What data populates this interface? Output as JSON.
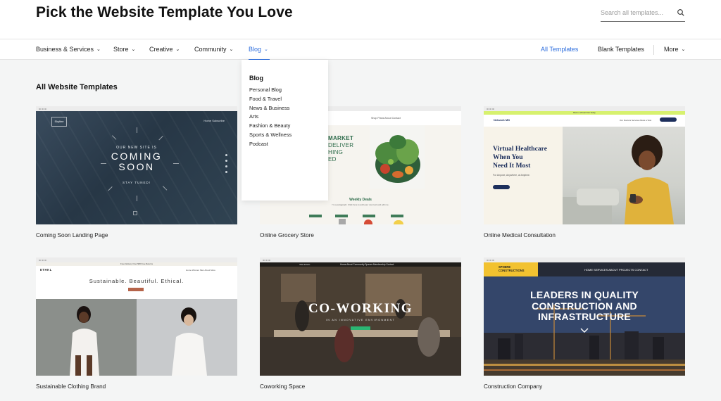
{
  "header": {
    "title": "Pick the Website Template You Love",
    "search_placeholder": "Search all templates..."
  },
  "nav": {
    "left": [
      {
        "label": "Business & Services"
      },
      {
        "label": "Store"
      },
      {
        "label": "Creative"
      },
      {
        "label": "Community"
      },
      {
        "label": "Blog",
        "active": true
      }
    ],
    "right": [
      {
        "label": "All Templates",
        "active": true
      },
      {
        "label": "Blank Templates"
      },
      {
        "label": "More"
      }
    ]
  },
  "dropdown": {
    "heading": "Blog",
    "items": [
      "Personal Blog",
      "Food & Travel",
      "News & Business",
      "Arts",
      "Fashion & Beauty",
      "Sports & Wellness",
      "Podcast"
    ]
  },
  "section_title": "All Website Templates",
  "templates": [
    {
      "label": "Coming Soon Landing Page",
      "thumb": {
        "logo": "Skyline",
        "nav": "Home   Subscribe",
        "eyebrow": "OUR NEW SITE IS",
        "headline_1": "COMING",
        "headline_2": "SOON",
        "footer": "STAY TUNED!"
      }
    },
    {
      "label": "Online Grocery Store",
      "thumb": {
        "nav": "Shop   Plans   About   Contact",
        "hero_1": "MARKET",
        "hero_2": "DELIVER",
        "hero_3": "HING",
        "hero_4": "ED",
        "section": "Weekly Deals",
        "section_sub": "I'm a paragraph. Click here to add your own text and edit me."
      }
    },
    {
      "label": "Online Medical Consultation",
      "thumb": {
        "banner": "Book a Virtual Visit Today",
        "logo": "Network MD",
        "nav": "Our Doctors   Services   Book a Visit",
        "headline_1": "Virtual Healthcare",
        "headline_2": "When You",
        "headline_3": "Need It Most",
        "sub": "For Anyone, Anywhere, at Anytime."
      }
    },
    {
      "label": "Sustainable Clothing Brand",
      "thumb": {
        "banner": "Free Delivery Over $50   Free Returns",
        "logo": "ETHKL",
        "nav": "Home   Women   Men   About   More",
        "headline": "Sustainable. Beautiful. Ethical."
      }
    },
    {
      "label": "Coworking Space",
      "thumb": {
        "logo": "The Annex.",
        "nav": "Home   About   Community   Spaces   Membership   Contact",
        "headline": "CO-WORKING",
        "sub": "IN AN INNOVATIVE ENVIRONMENT"
      }
    },
    {
      "label": "Construction Company",
      "thumb": {
        "logo_1": "SPHERE",
        "logo_2": "CONSTRUCTIONS",
        "nav": "HOME     SERVICES     ABOUT     PROJECTS     CONTACT",
        "headline_1": "LEADERS IN QUALITY",
        "headline_2": "CONSTRUCTION AND",
        "headline_3": "INFRASTRUCTURE"
      }
    }
  ],
  "colors": {
    "accent": "#2f6fde",
    "grocery_green": "#2d6b4a",
    "medical_navy": "#1d2f5c",
    "medical_lime": "#d7f16e",
    "construction_yellow": "#f2c230",
    "cowork_green": "#2bb673"
  },
  "icons": {
    "search": "search-icon",
    "chevron": "chevron-down-icon"
  }
}
